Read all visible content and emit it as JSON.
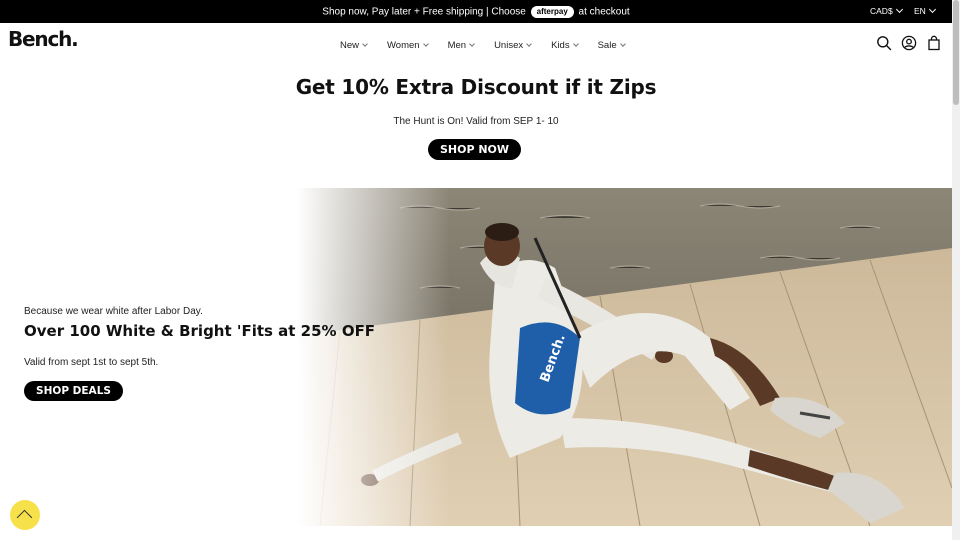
{
  "announcement": {
    "text_before": "Shop now, Pay later + Free shipping | Choose",
    "afterpay": "afterpay",
    "text_after": "at checkout",
    "currency": "CAD$",
    "language": "EN"
  },
  "header": {
    "logo": "Bench.",
    "nav": [
      "New",
      "Women",
      "Men",
      "Unisex",
      "Kids",
      "Sale"
    ],
    "icons": [
      "search-icon",
      "account-icon",
      "bag-icon"
    ]
  },
  "promo": {
    "title": "Get 10% Extra Discount if it Zips",
    "subtitle": "The Hunt is On! Valid from SEP 1- 10",
    "button": "SHOP NOW"
  },
  "hero": {
    "pre": "Because we wear white after Labor Day.",
    "title": "Over 100 White & Bright 'Fits at 25% OFF",
    "valid": "Valid from sept 1st to sept 5th.",
    "button": "SHOP DEALS",
    "bag_text": "Bench."
  },
  "colors": {
    "announcement_bg": "#000000",
    "scroll_button": "#f7e14b",
    "button_bg": "#000000"
  }
}
